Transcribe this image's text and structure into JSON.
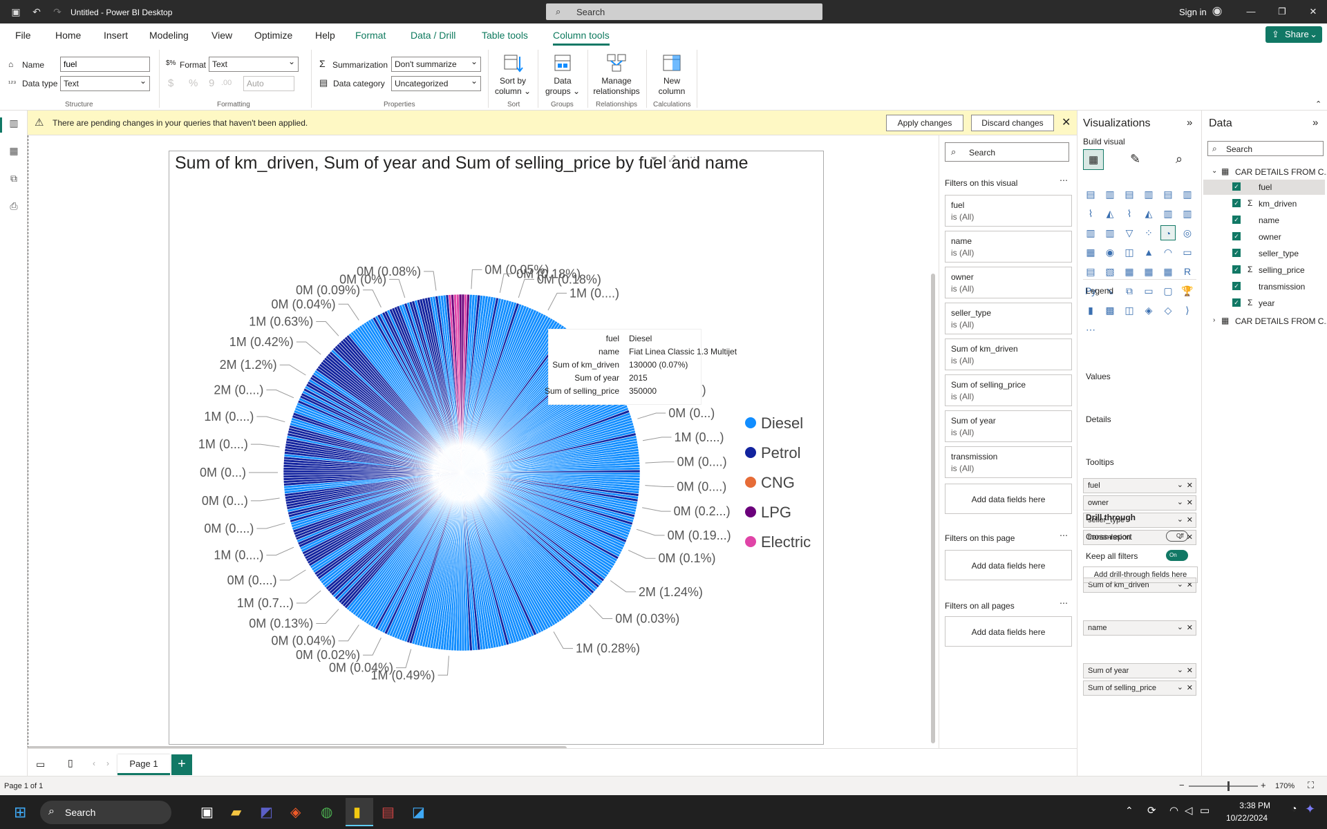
{
  "window": {
    "title": "Untitled - Power BI Desktop",
    "search_placeholder": "Search",
    "signin": "Sign in"
  },
  "menu": {
    "items": [
      "File",
      "Home",
      "Insert",
      "Modeling",
      "View",
      "Optimize",
      "Help",
      "Format",
      "Data / Drill",
      "Table tools",
      "Column tools"
    ],
    "share": "Share"
  },
  "ribbon": {
    "name_label": "Name",
    "name_value": "fuel",
    "datatype_label": "Data type",
    "datatype_value": "Text",
    "format_label": "Format",
    "format_value": "Text",
    "auto_value": "Auto",
    "summarization_label": "Summarization",
    "summarization_value": "Don't summarize",
    "datacategory_label": "Data category",
    "datacategory_value": "Uncategorized",
    "sort_by_column": "Sort by column",
    "data_groups": "Data groups",
    "manage_relationships": "Manage relationships",
    "new_column": "New column",
    "groups": [
      "Structure",
      "Formatting",
      "Properties",
      "Sort",
      "Groups",
      "Relationships",
      "Calculations"
    ]
  },
  "pending": {
    "message": "There are pending changes in your queries that haven't been applied.",
    "apply": "Apply changes",
    "discard": "Discard changes"
  },
  "visual": {
    "title": "Sum of km_driven, Sum of year and Sum of selling_price by fuel and name"
  },
  "tooltip": {
    "rows": [
      [
        "fuel",
        "Diesel"
      ],
      [
        "name",
        "Fiat Linea Classic 1.3 Multijet"
      ],
      [
        "Sum of km_driven",
        "130000 (0.07%)"
      ],
      [
        "Sum of year",
        "2015"
      ],
      [
        "Sum of selling_price",
        "350000"
      ]
    ]
  },
  "chart_data": {
    "type": "pie",
    "legend_position": "right",
    "legend": [
      {
        "name": "Diesel",
        "color": "#118DFF"
      },
      {
        "name": "Petrol",
        "color": "#12239E"
      },
      {
        "name": "CNG",
        "color": "#E66C37"
      },
      {
        "name": "LPG",
        "color": "#6B007B"
      },
      {
        "name": "Electric",
        "color": "#E044A7"
      }
    ],
    "data_labels": [
      "0M (0.05%)",
      "0M (0.18%)",
      "0M (0.18%)",
      "1M (0....)",
      "0M (0....)",
      "1M (0...)",
      "0M (0...)",
      "1M (0....)",
      "0M (0....)",
      "0M (0....)",
      "0M (0.2...)",
      "0M (0.19...)",
      "0M (0.1%)",
      "2M (1.24%)",
      "0M (0.03%)",
      "1M (0.28%)",
      "1M (0.49%)",
      "0M (0.04%)",
      "0M (0.02%)",
      "0M (0.04%)",
      "0M (0.13%)",
      "1M (0.7...)",
      "0M (0....)",
      "1M (0....)",
      "0M (0....)",
      "0M (0...)",
      "0M (0...)",
      "1M (0....)",
      "1M (0....)",
      "2M (0....)",
      "2M (1.2%)",
      "1M (0.42%)",
      "1M (0.63%)",
      "0M (0.04%)",
      "0M (0.09%)",
      "0M (0%)",
      "0M (0.08%)"
    ]
  },
  "filters": {
    "search": "Search",
    "visual_header": "Filters on this visual",
    "cards": [
      {
        "name": "fuel",
        "state": "is (All)"
      },
      {
        "name": "name",
        "state": "is (All)"
      },
      {
        "name": "owner",
        "state": "is (All)"
      },
      {
        "name": "seller_type",
        "state": "is (All)"
      },
      {
        "name": "Sum of km_driven",
        "state": "is (All)"
      },
      {
        "name": "Sum of selling_price",
        "state": "is (All)"
      },
      {
        "name": "Sum of year",
        "state": "is (All)"
      },
      {
        "name": "transmission",
        "state": "is (All)"
      }
    ],
    "add": "Add data fields here",
    "page_header": "Filters on this page",
    "all_header": "Filters on all pages"
  },
  "viz": {
    "title": "Visualizations",
    "build": "Build visual",
    "legend_hdr": "Legend",
    "legend_fields": [
      "fuel",
      "owner",
      "seller_type",
      "transmission"
    ],
    "values_hdr": "Values",
    "values_fields": [
      "Sum of km_driven"
    ],
    "details_hdr": "Details",
    "details_fields": [
      "name"
    ],
    "tooltips_hdr": "Tooltips",
    "tooltips_fields": [
      "Sum of year",
      "Sum of selling_price"
    ],
    "drill_hdr": "Drill through",
    "cross_report": "Cross-report",
    "cross_state": "Off",
    "keep_filters": "Keep all filters",
    "keep_state": "On",
    "add_drill": "Add drill-through fields here"
  },
  "data": {
    "title": "Data",
    "search": "Search",
    "table": "CAR DETAILS FROM C...",
    "fields": [
      {
        "name": "fuel",
        "sigma": false
      },
      {
        "name": "km_driven",
        "sigma": true
      },
      {
        "name": "name",
        "sigma": false
      },
      {
        "name": "owner",
        "sigma": false
      },
      {
        "name": "seller_type",
        "sigma": false
      },
      {
        "name": "selling_price",
        "sigma": true
      },
      {
        "name": "transmission",
        "sigma": false
      },
      {
        "name": "year",
        "sigma": true
      }
    ],
    "table2": "CAR DETAILS FROM C..."
  },
  "pages": {
    "tab": "Page 1",
    "status": "Page 1 of 1",
    "zoom": "170%"
  },
  "taskbar": {
    "search": "Search",
    "time": "3:38 PM",
    "date": "10/22/2024"
  }
}
